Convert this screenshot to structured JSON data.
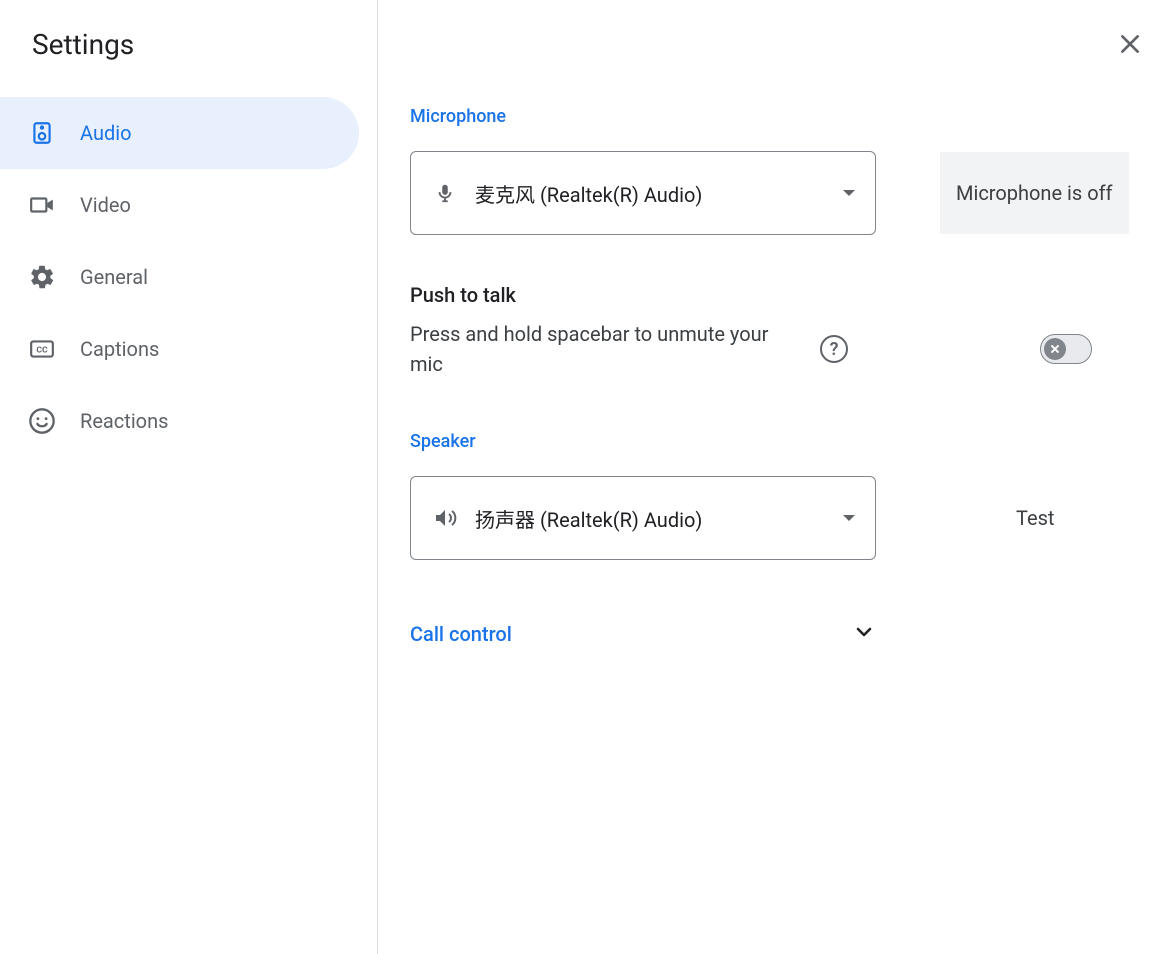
{
  "title": "Settings",
  "nav": {
    "items": [
      {
        "label": "Audio",
        "icon": "speaker-icon",
        "active": true
      },
      {
        "label": "Video",
        "icon": "video-icon",
        "active": false
      },
      {
        "label": "General",
        "icon": "gear-icon",
        "active": false
      },
      {
        "label": "Captions",
        "icon": "captions-icon",
        "active": false
      },
      {
        "label": "Reactions",
        "icon": "smile-icon",
        "active": false
      }
    ]
  },
  "main": {
    "microphone": {
      "label": "Microphone",
      "selected": "麦克风 (Realtek(R) Audio)",
      "status": "Microphone is off"
    },
    "push_to_talk": {
      "title": "Push to talk",
      "description": "Press and hold spacebar to unmute your mic",
      "enabled": false
    },
    "speaker": {
      "label": "Speaker",
      "selected": "扬声器 (Realtek(R) Audio)",
      "test_label": "Test"
    },
    "call_control": {
      "label": "Call control"
    }
  }
}
